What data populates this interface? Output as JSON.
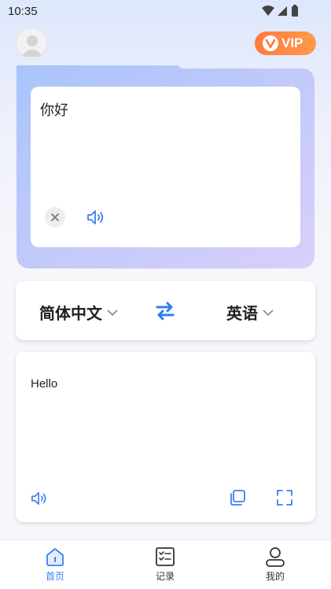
{
  "status_bar": {
    "time": "10:35"
  },
  "header": {
    "vip_label": "VIP"
  },
  "input": {
    "text": "你好"
  },
  "languages": {
    "source": "简体中文",
    "target": "英语"
  },
  "output": {
    "text": "Hello"
  },
  "nav": {
    "items": [
      {
        "label": "首页",
        "icon": "home-icon",
        "active": true
      },
      {
        "label": "记录",
        "icon": "record-icon",
        "active": false
      },
      {
        "label": "我的",
        "icon": "profile-icon",
        "active": false
      }
    ]
  },
  "colors": {
    "accent": "#3d7ff5",
    "vip_orange": "#ff8442",
    "gradient_start": "#a9c4fb",
    "gradient_end": "#d6ccfa"
  }
}
